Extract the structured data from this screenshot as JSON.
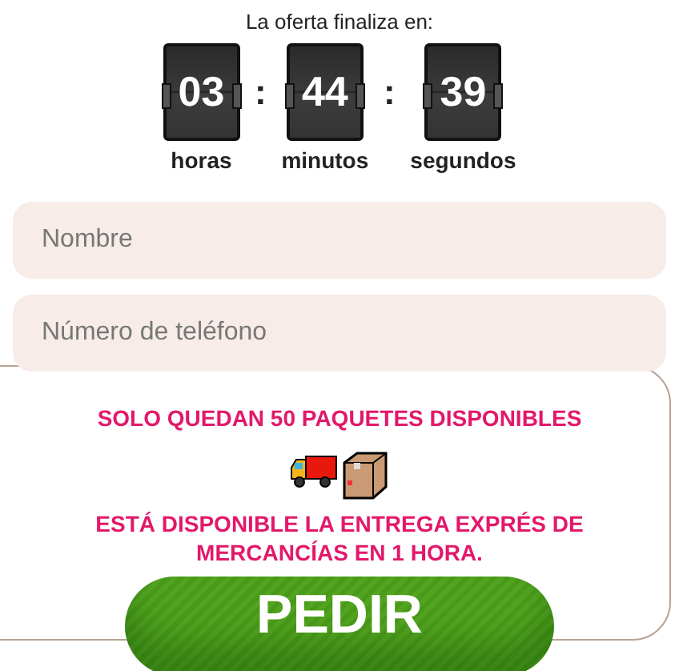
{
  "countdown": {
    "title": "La oferta finaliza en:",
    "units": [
      {
        "value": "03",
        "label": "horas"
      },
      {
        "value": "44",
        "label": "minutos"
      },
      {
        "value": "39",
        "label": "segundos"
      }
    ],
    "separator": ":"
  },
  "fields": [
    {
      "placeholder": "Nombre"
    },
    {
      "placeholder": "Número de teléfono"
    }
  ],
  "stock_notice": "SOLO QUEDAN 50 PAQUETES DISPONIBLES",
  "delivery_notice": "ESTÁ DISPONIBLE LA ENTREGA EXPRÉS DE MERCANCÍAS EN 1 HORA.",
  "order_button": "PEDIR"
}
